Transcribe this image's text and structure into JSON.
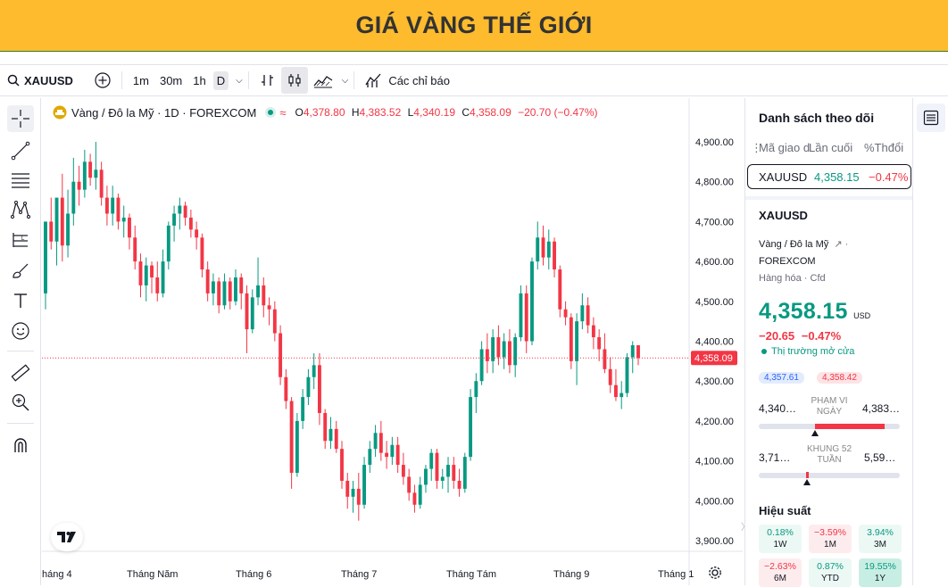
{
  "banner": {
    "title": "GIÁ VÀNG THẾ GIỚI"
  },
  "toolbar": {
    "symbol": "XAUUSD",
    "intervals": [
      "1m",
      "30m",
      "1h",
      "D"
    ],
    "active_interval": "D",
    "indicators_label": "Các chỉ báo"
  },
  "legend": {
    "title": "Vàng / Đô la Mỹ · 1D · FOREXCOM",
    "o_label": "O",
    "o": "4,378.80",
    "h_label": "H",
    "h": "4,383.52",
    "l_label": "L",
    "l": "4,340.19",
    "c_label": "C",
    "c": "4,358.09",
    "change": "−20.70 (−0.47%)"
  },
  "price_axis": {
    "ticks": [
      "4,900.00",
      "4,800.00",
      "4,700.00",
      "4,600.00",
      "4,500.00",
      "4,400.00",
      "4,300.00",
      "4,200.00",
      "4,100.00",
      "4,000.00",
      "3,900.00"
    ],
    "current_label": "4,358.09"
  },
  "time_axis": {
    "ticks": [
      "háng 4",
      "Tháng Năm",
      "Tháng 6",
      "Tháng 7",
      "Tháng Tám",
      "Tháng 9",
      "Tháng 1"
    ]
  },
  "chart_data": {
    "type": "candlestick",
    "ylim": [
      3860,
      4960
    ],
    "current_price": 4358.09,
    "candles": [
      {
        "o": 4520,
        "h": 4625,
        "l": 4480,
        "c": 4700
      },
      {
        "o": 4700,
        "h": 4760,
        "l": 4630,
        "c": 4650
      },
      {
        "o": 4650,
        "h": 4720,
        "l": 4590,
        "c": 4760
      },
      {
        "o": 4760,
        "h": 4820,
        "l": 4600,
        "c": 4640
      },
      {
        "o": 4640,
        "h": 4780,
        "l": 4610,
        "c": 4720
      },
      {
        "o": 4720,
        "h": 4860,
        "l": 4690,
        "c": 4800
      },
      {
        "o": 4800,
        "h": 4840,
        "l": 4740,
        "c": 4780
      },
      {
        "o": 4780,
        "h": 4880,
        "l": 4760,
        "c": 4850
      },
      {
        "o": 4850,
        "h": 4870,
        "l": 4790,
        "c": 4810
      },
      {
        "o": 4810,
        "h": 4900,
        "l": 4780,
        "c": 4830
      },
      {
        "o": 4830,
        "h": 4850,
        "l": 4740,
        "c": 4760
      },
      {
        "o": 4760,
        "h": 4790,
        "l": 4690,
        "c": 4720
      },
      {
        "o": 4720,
        "h": 4790,
        "l": 4690,
        "c": 4760
      },
      {
        "o": 4760,
        "h": 4770,
        "l": 4680,
        "c": 4700
      },
      {
        "o": 4700,
        "h": 4740,
        "l": 4660,
        "c": 4710
      },
      {
        "o": 4710,
        "h": 4720,
        "l": 4630,
        "c": 4660
      },
      {
        "o": 4660,
        "h": 4690,
        "l": 4580,
        "c": 4600
      },
      {
        "o": 4600,
        "h": 4620,
        "l": 4510,
        "c": 4540
      },
      {
        "o": 4540,
        "h": 4610,
        "l": 4500,
        "c": 4590
      },
      {
        "o": 4590,
        "h": 4600,
        "l": 4520,
        "c": 4560
      },
      {
        "o": 4560,
        "h": 4600,
        "l": 4500,
        "c": 4520
      },
      {
        "o": 4520,
        "h": 4630,
        "l": 4510,
        "c": 4600
      },
      {
        "o": 4600,
        "h": 4700,
        "l": 4580,
        "c": 4690
      },
      {
        "o": 4690,
        "h": 4740,
        "l": 4650,
        "c": 4720
      },
      {
        "o": 4720,
        "h": 4760,
        "l": 4680,
        "c": 4740
      },
      {
        "o": 4740,
        "h": 4750,
        "l": 4690,
        "c": 4710
      },
      {
        "o": 4710,
        "h": 4730,
        "l": 4660,
        "c": 4680
      },
      {
        "o": 4680,
        "h": 4700,
        "l": 4630,
        "c": 4660
      },
      {
        "o": 4660,
        "h": 4670,
        "l": 4560,
        "c": 4580
      },
      {
        "o": 4580,
        "h": 4600,
        "l": 4500,
        "c": 4520
      },
      {
        "o": 4520,
        "h": 4570,
        "l": 4490,
        "c": 4550
      },
      {
        "o": 4550,
        "h": 4560,
        "l": 4470,
        "c": 4490
      },
      {
        "o": 4490,
        "h": 4570,
        "l": 4480,
        "c": 4550
      },
      {
        "o": 4550,
        "h": 4560,
        "l": 4480,
        "c": 4500
      },
      {
        "o": 4500,
        "h": 4580,
        "l": 4490,
        "c": 4560
      },
      {
        "o": 4560,
        "h": 4570,
        "l": 4480,
        "c": 4520
      },
      {
        "o": 4520,
        "h": 4540,
        "l": 4370,
        "c": 4430
      },
      {
        "o": 4430,
        "h": 4530,
        "l": 4420,
        "c": 4510
      },
      {
        "o": 4510,
        "h": 4610,
        "l": 4490,
        "c": 4540
      },
      {
        "o": 4540,
        "h": 4560,
        "l": 4460,
        "c": 4490
      },
      {
        "o": 4490,
        "h": 4510,
        "l": 4440,
        "c": 4480
      },
      {
        "o": 4480,
        "h": 4500,
        "l": 4400,
        "c": 4420
      },
      {
        "o": 4420,
        "h": 4440,
        "l": 4290,
        "c": 4310
      },
      {
        "o": 4310,
        "h": 4330,
        "l": 4230,
        "c": 4250
      },
      {
        "o": 4250,
        "h": 4260,
        "l": 4030,
        "c": 4070
      },
      {
        "o": 4070,
        "h": 4220,
        "l": 4060,
        "c": 4200
      },
      {
        "o": 4200,
        "h": 4280,
        "l": 4180,
        "c": 4260
      },
      {
        "o": 4260,
        "h": 4330,
        "l": 4240,
        "c": 4310
      },
      {
        "o": 4310,
        "h": 4370,
        "l": 4280,
        "c": 4340
      },
      {
        "o": 4340,
        "h": 4370,
        "l": 4190,
        "c": 4220
      },
      {
        "o": 4220,
        "h": 4230,
        "l": 4130,
        "c": 4150
      },
      {
        "o": 4150,
        "h": 4210,
        "l": 4130,
        "c": 4180
      },
      {
        "o": 4180,
        "h": 4200,
        "l": 4120,
        "c": 4130
      },
      {
        "o": 4130,
        "h": 4150,
        "l": 4030,
        "c": 4050
      },
      {
        "o": 4050,
        "h": 4070,
        "l": 3980,
        "c": 4010
      },
      {
        "o": 4010,
        "h": 4050,
        "l": 3970,
        "c": 4030
      },
      {
        "o": 4030,
        "h": 4070,
        "l": 3950,
        "c": 3990
      },
      {
        "o": 3990,
        "h": 4110,
        "l": 3980,
        "c": 4090
      },
      {
        "o": 4090,
        "h": 4150,
        "l": 4070,
        "c": 4130
      },
      {
        "o": 4130,
        "h": 4190,
        "l": 4110,
        "c": 4170
      },
      {
        "o": 4170,
        "h": 4200,
        "l": 4100,
        "c": 4120
      },
      {
        "o": 4120,
        "h": 4150,
        "l": 4080,
        "c": 4110
      },
      {
        "o": 4110,
        "h": 4160,
        "l": 4090,
        "c": 4140
      },
      {
        "o": 4140,
        "h": 4160,
        "l": 4070,
        "c": 4090
      },
      {
        "o": 4090,
        "h": 4120,
        "l": 4040,
        "c": 4060
      },
      {
        "o": 4060,
        "h": 4080,
        "l": 4000,
        "c": 4020
      },
      {
        "o": 4020,
        "h": 4040,
        "l": 3970,
        "c": 3990
      },
      {
        "o": 3990,
        "h": 4060,
        "l": 3980,
        "c": 4040
      },
      {
        "o": 4040,
        "h": 4090,
        "l": 4020,
        "c": 4080
      },
      {
        "o": 4080,
        "h": 4130,
        "l": 4050,
        "c": 4120
      },
      {
        "o": 4120,
        "h": 4130,
        "l": 4030,
        "c": 4050
      },
      {
        "o": 4050,
        "h": 4080,
        "l": 4030,
        "c": 4060
      },
      {
        "o": 4060,
        "h": 4110,
        "l": 4020,
        "c": 4090
      },
      {
        "o": 4090,
        "h": 4110,
        "l": 4030,
        "c": 4050
      },
      {
        "o": 4050,
        "h": 4080,
        "l": 4010,
        "c": 4030
      },
      {
        "o": 4030,
        "h": 4120,
        "l": 4020,
        "c": 4110
      },
      {
        "o": 4110,
        "h": 4280,
        "l": 4100,
        "c": 4260
      },
      {
        "o": 4260,
        "h": 4320,
        "l": 4220,
        "c": 4300
      },
      {
        "o": 4300,
        "h": 4400,
        "l": 4290,
        "c": 4380
      },
      {
        "o": 4380,
        "h": 4420,
        "l": 4320,
        "c": 4350
      },
      {
        "o": 4350,
        "h": 4430,
        "l": 4320,
        "c": 4410
      },
      {
        "o": 4410,
        "h": 4440,
        "l": 4340,
        "c": 4360
      },
      {
        "o": 4360,
        "h": 4420,
        "l": 4330,
        "c": 4400
      },
      {
        "o": 4400,
        "h": 4430,
        "l": 4320,
        "c": 4340
      },
      {
        "o": 4340,
        "h": 4420,
        "l": 4310,
        "c": 4410
      },
      {
        "o": 4410,
        "h": 4540,
        "l": 4400,
        "c": 4520
      },
      {
        "o": 4520,
        "h": 4540,
        "l": 4370,
        "c": 4400
      },
      {
        "o": 4400,
        "h": 4610,
        "l": 4390,
        "c": 4600
      },
      {
        "o": 4600,
        "h": 4700,
        "l": 4580,
        "c": 4660
      },
      {
        "o": 4660,
        "h": 4690,
        "l": 4590,
        "c": 4610
      },
      {
        "o": 4610,
        "h": 4680,
        "l": 4580,
        "c": 4650
      },
      {
        "o": 4650,
        "h": 4660,
        "l": 4560,
        "c": 4580
      },
      {
        "o": 4580,
        "h": 4590,
        "l": 4460,
        "c": 4480
      },
      {
        "o": 4480,
        "h": 4500,
        "l": 4440,
        "c": 4460
      },
      {
        "o": 4460,
        "h": 4470,
        "l": 4330,
        "c": 4350
      },
      {
        "o": 4350,
        "h": 4470,
        "l": 4290,
        "c": 4450
      },
      {
        "o": 4450,
        "h": 4520,
        "l": 4430,
        "c": 4490
      },
      {
        "o": 4490,
        "h": 4510,
        "l": 4420,
        "c": 4440
      },
      {
        "o": 4440,
        "h": 4460,
        "l": 4380,
        "c": 4410
      },
      {
        "o": 4410,
        "h": 4430,
        "l": 4350,
        "c": 4380
      },
      {
        "o": 4380,
        "h": 4420,
        "l": 4320,
        "c": 4330
      },
      {
        "o": 4330,
        "h": 4360,
        "l": 4270,
        "c": 4290
      },
      {
        "o": 4290,
        "h": 4330,
        "l": 4250,
        "c": 4260
      },
      {
        "o": 4260,
        "h": 4300,
        "l": 4230,
        "c": 4270
      },
      {
        "o": 4270,
        "h": 4370,
        "l": 4260,
        "c": 4360
      },
      {
        "o": 4360,
        "h": 4400,
        "l": 4320,
        "c": 4390
      },
      {
        "o": 4390,
        "h": 4390,
        "l": 4340,
        "c": 4358
      }
    ]
  },
  "watchlist": {
    "title": "Danh sách theo dõi",
    "col_symbol": "Mã giao d",
    "col_last": "Lần cuối",
    "col_change": "%Thđổi",
    "row": {
      "symbol": "XAUUSD",
      "last": "4,358.15",
      "change": "−0.47%"
    }
  },
  "details": {
    "symbol": "XAUUSD",
    "description": "Vàng / Đô la Mỹ",
    "exchange": "FOREXCOM",
    "category": "Hàng hóa",
    "type": "Cfd",
    "price": "4,358.15",
    "currency": "USD",
    "change_abs": "−20.65",
    "change_pct": "−0.47%",
    "market_status": "Thị trường mở cửa",
    "bid": "4,357.61",
    "ask": "4,358.42",
    "day_low": "4,340…",
    "day_high": "4,383…",
    "day_range_label_1": "PHẠM VI",
    "day_range_label_2": "NGÀY",
    "day_marker": 0.4,
    "wk52_low": "3,71…",
    "wk52_high": "5,59…",
    "wk52_label_1": "KHUNG 52",
    "wk52_label_2": "TUẦN",
    "wk52_marker": 0.34,
    "perf_title": "Hiệu suất",
    "perf": [
      {
        "value": "0.18%",
        "label": "1W",
        "dir": "up"
      },
      {
        "value": "−3.59%",
        "label": "1M",
        "dir": "down"
      },
      {
        "value": "3.94%",
        "label": "3M",
        "dir": "up"
      },
      {
        "value": "−2.63%",
        "label": "6M",
        "dir": "down"
      },
      {
        "value": "0.87%",
        "label": "YTD",
        "dir": "up"
      },
      {
        "value": "19.55%",
        "label": "1Y",
        "dir": "up"
      }
    ]
  },
  "colors": {
    "banner": "#FDBB2D",
    "up": "#089981",
    "down": "#F23645",
    "price_tag": "#F23645"
  }
}
